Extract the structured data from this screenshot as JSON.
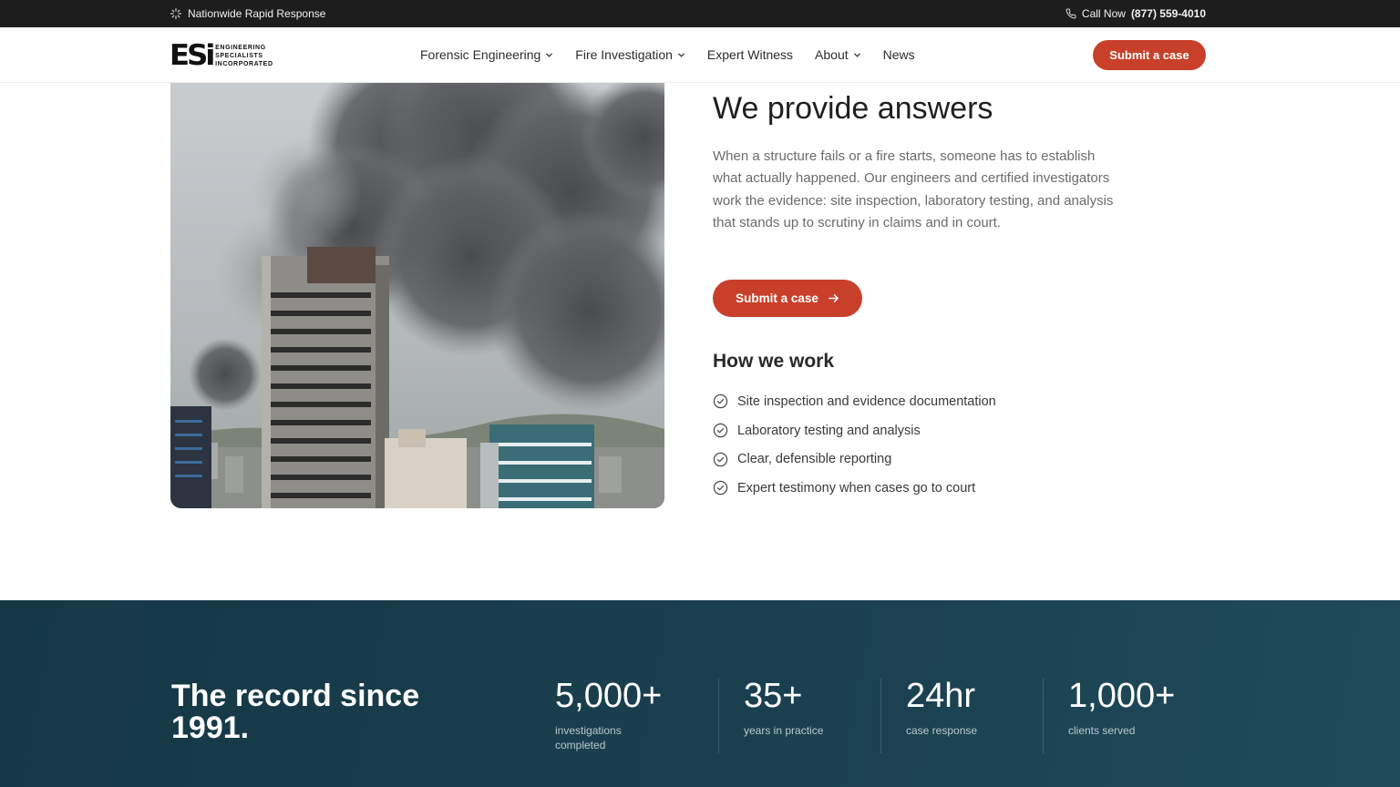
{
  "topbar": {
    "tagline": "Nationwide Rapid Response",
    "call_label": "Call Now",
    "phone": "(877) 559-4010"
  },
  "header": {
    "logo_mark": "ESi",
    "logo_lines": [
      "ENGINEERING",
      "SPECIALISTS",
      "INCORPORATED"
    ],
    "nav": [
      {
        "label": "Forensic Engineering",
        "dropdown": true
      },
      {
        "label": "Fire Investigation",
        "dropdown": true
      },
      {
        "label": "Expert Witness",
        "dropdown": false
      },
      {
        "label": "About",
        "dropdown": true
      },
      {
        "label": "News",
        "dropdown": false
      }
    ],
    "cta_label": "Submit a case"
  },
  "hero": {
    "image_icon": "burning-high-rise-photo",
    "title": "We provide answers",
    "lead": "When a structure fails or a fire starts, someone has to establish what actually happened. Our engineers and certified investigators work the evidence: site inspection, laboratory testing, and analysis that stands up to scrutiny in claims and in court.",
    "cta_label": "Submit a case",
    "how_title": "How we work",
    "steps": [
      "Site inspection and evidence documentation",
      "Laboratory testing and analysis",
      "Clear, defensible reporting",
      "Expert testimony when cases go to court"
    ]
  },
  "record": {
    "title": "The record since 1991.",
    "stats": [
      {
        "value": "5,000+",
        "label": "investigations completed"
      },
      {
        "value": "35+",
        "label": "years in practice"
      },
      {
        "value": "24hr",
        "label": "case response"
      },
      {
        "value": "1,000+",
        "label": "clients served"
      }
    ]
  },
  "colors": {
    "accent": "#c8402a",
    "topbar": "#1d1d1d",
    "band": "#1a3f4e"
  }
}
